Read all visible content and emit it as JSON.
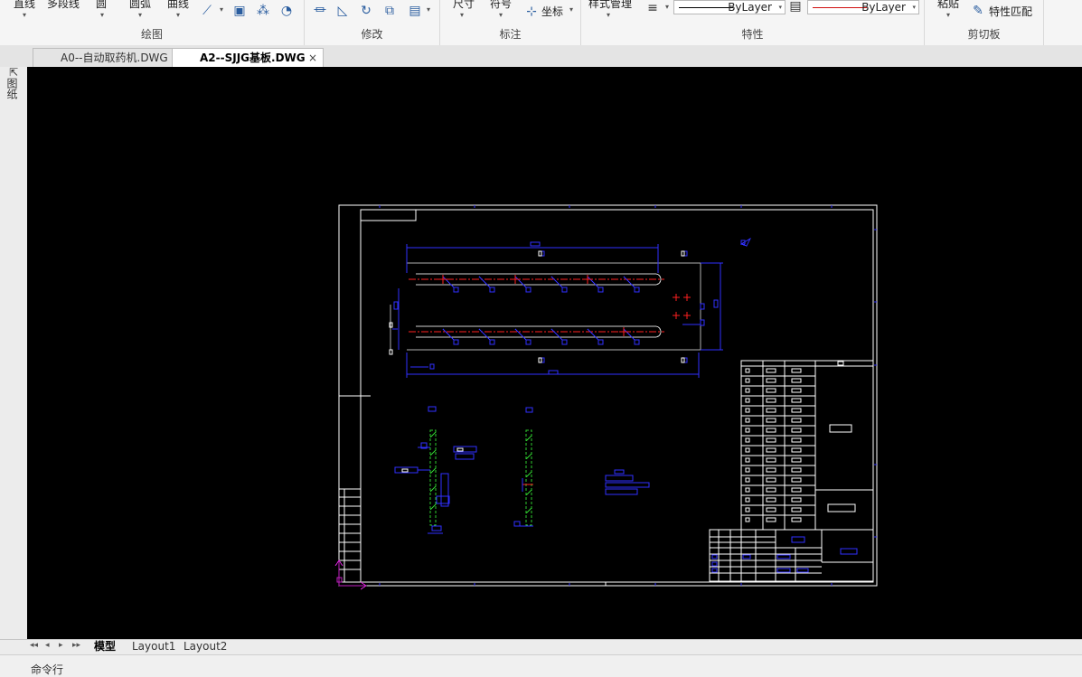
{
  "ribbon": {
    "draw": {
      "title": "绘图",
      "tools": [
        "直线",
        "多段线",
        "圆",
        "圆弧",
        "曲线"
      ]
    },
    "modify": {
      "title": "修改"
    },
    "annotate": {
      "title": "标注",
      "tools": [
        "尺寸",
        "符号",
        "坐标"
      ]
    },
    "properties": {
      "title": "特性",
      "style_manager": "样式管理",
      "linetype_value": "ByLayer",
      "color_value": "ByLayer"
    },
    "clipboard": {
      "title": "剪切板",
      "paste": "粘贴",
      "match_properties": "特性匹配"
    }
  },
  "document_tabs": [
    {
      "label": "A0--自动取药机.DWG",
      "active": false
    },
    {
      "label": "A2--SJJG基板.DWG",
      "active": true
    }
  ],
  "close_symbol": "×",
  "side_panel": {
    "label": "图纸"
  },
  "layout_tabs": [
    "模型",
    "Layout1",
    "Layout2"
  ],
  "command_line": {
    "label": "命令行"
  },
  "colors": {
    "canvas_bg": "#000000",
    "drawing_white": "#ffffff",
    "drawing_blue": "#2a2aff",
    "centerline_red": "#ff2020",
    "hatch_green": "#2ecc2e",
    "ucs_magenta": "#c020c0"
  }
}
